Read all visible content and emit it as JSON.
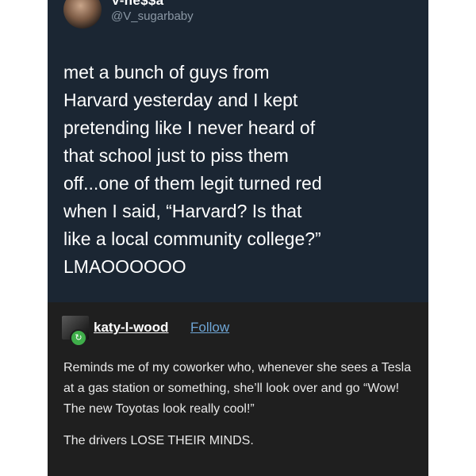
{
  "tweet": {
    "display_name": "V-ne$$a",
    "handle": "@V_sugarbaby",
    "text": "met a bunch of guys from\nHarvard yesterday and I kept\npretending like I never heard of\nthat school just to piss them\noff...one of them legit turned red\nwhen I said, “Harvard? Is that\nlike a local community college?”\nLMAOOOOOO"
  },
  "reblog": {
    "username": "katy-l-wood",
    "follow_label": "Follow",
    "badge_icon": "reblog-icon",
    "paragraphs": [
      "Reminds me of my coworker who, whenever she sees a Tesla at a gas station or something, she’ll look over and go “Wow! The new Toyotas look really cool!”",
      "The drivers LOSE THEIR MINDS."
    ]
  },
  "colors": {
    "tweet_background": "#1b2633",
    "reblog_background": "#1f1f1f",
    "handle_text": "#8b98a5",
    "follow_link": "#6fa6d6",
    "reblog_badge": "#3fae4a"
  }
}
